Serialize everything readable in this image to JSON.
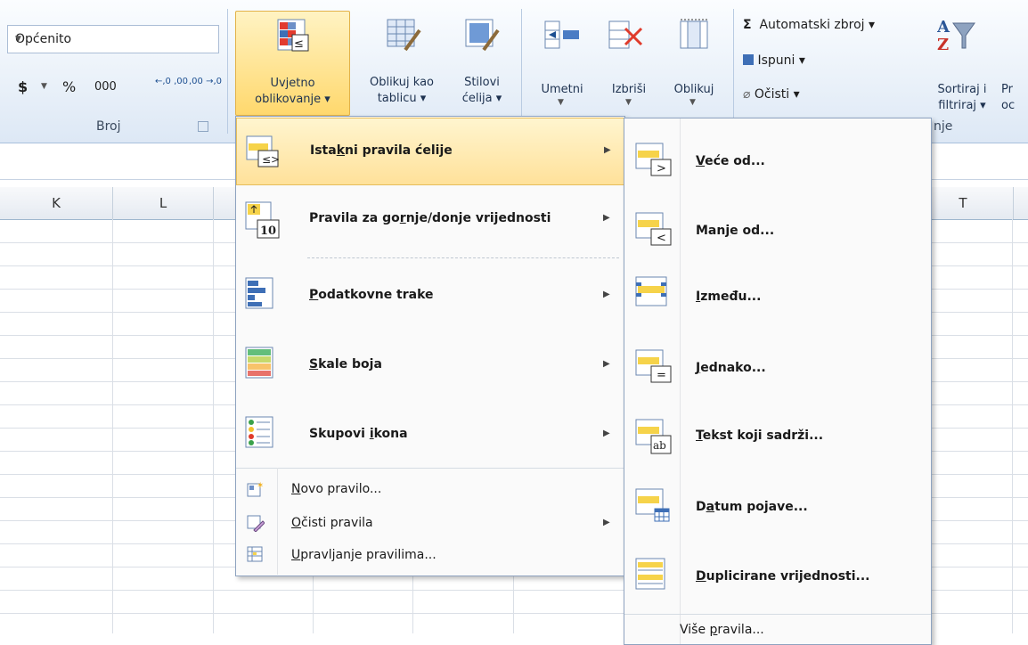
{
  "ribbon": {
    "number_format": "Općenito",
    "currency": "$",
    "percent": "%",
    "thousands": "000",
    "inc_decimal": "←,0 ,00",
    "dec_decimal": ",00 →,0",
    "group_number": "Broj",
    "cf_line1": "Uvjetno",
    "cf_line2": "oblikovanje",
    "table_line1": "Oblikuj kao",
    "table_line2": "tablicu",
    "styles_line1": "Stilovi",
    "styles_line2": "ćelija",
    "insert": "Umetni",
    "delete": "Izbriši",
    "format": "Oblikuj",
    "autosum": "Automatski zbroj",
    "fill": "Ispuni",
    "clear": "Očisti",
    "sort_line1": "Sortiraj i",
    "sort_line2": "filtriraj",
    "find_line1": "Pr",
    "find_line2": "oc",
    "group_editing": "nje",
    "sigma": "Σ"
  },
  "columns": [
    "K",
    "L",
    "T"
  ],
  "cf_menu": {
    "items": [
      {
        "pre": "Ista",
        "u": "k",
        "post": "ni pravila ćelije"
      },
      {
        "pre": "Pravila za go",
        "u": "r",
        "post": "nje/donje vrijednosti"
      },
      {
        "pre": "",
        "u": "P",
        "post": "odatkovne trake"
      },
      {
        "pre": "",
        "u": "S",
        "post": "kale boja"
      },
      {
        "pre": "Skupovi ",
        "u": "i",
        "post": "kona"
      }
    ],
    "small": [
      {
        "pre": "",
        "u": "N",
        "post": "ovo pravilo..."
      },
      {
        "pre": "",
        "u": "O",
        "post": "čisti pravila"
      },
      {
        "pre": "",
        "u": "U",
        "post": "pravljanje pravilima..."
      }
    ]
  },
  "sub_menu": {
    "items": [
      {
        "pre": "",
        "u": "V",
        "post": "eće od..."
      },
      {
        "pre": "Man",
        "u": "j",
        "post": "e od..."
      },
      {
        "pre": "",
        "u": "I",
        "post": "zmeđu..."
      },
      {
        "pre": "",
        "u": "J",
        "post": "ednako..."
      },
      {
        "pre": "",
        "u": "T",
        "post": "ekst koji sadrži..."
      },
      {
        "pre": "D",
        "u": "a",
        "post": "tum pojave..."
      },
      {
        "pre": "",
        "u": "D",
        "post": "uplicirane vrijednosti..."
      }
    ],
    "more": {
      "pre": "Više ",
      "u": "p",
      "post": "ravila..."
    },
    "icon_glyphs": [
      ">",
      "<",
      "",
      "=",
      "ab",
      "",
      ""
    ]
  },
  "colors": {
    "highlight": "#ffe9a8",
    "accent_blue": "#3e6fb6",
    "red": "#e03b2b"
  }
}
